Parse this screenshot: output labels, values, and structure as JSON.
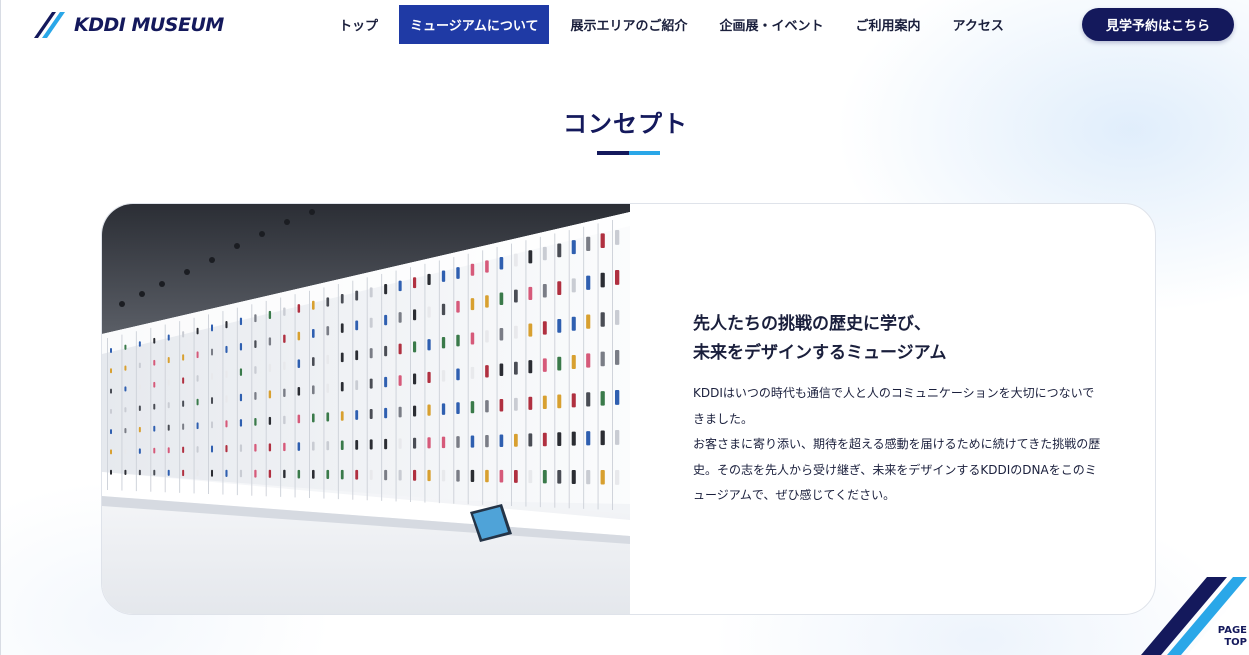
{
  "header": {
    "logo_text": "KDDI MUSEUM",
    "nav": [
      {
        "label": "トップ",
        "active": false
      },
      {
        "label": "ミュージアムについて",
        "active": true
      },
      {
        "label": "展示エリアのご紹介",
        "active": false
      },
      {
        "label": "企画展・イベント",
        "active": false
      },
      {
        "label": "ご利用案内",
        "active": false
      },
      {
        "label": "アクセス",
        "active": false
      }
    ],
    "reserve_label": "見学予約はこちら"
  },
  "section": {
    "title": "コンセプト"
  },
  "concept": {
    "headline_1": "先人たちの挑戦の歴史に学び、",
    "headline_2": "未来をデザインするミュージアム",
    "body_1": "KDDIはいつの時代も通信で人と人のコミュニケーションを大切につないできました。",
    "body_2": "お客さまに寄り添い、期待を超える感動を届けるために続けてきた挑戦の歴史。その志を先人から受け継ぎ、未来をデザインするKDDIのDNAをこのミュージアムで、ぜひ感じてください。"
  },
  "page_top": {
    "label": "PAGE\nTOP"
  },
  "colors": {
    "navy": "#14195c",
    "nav_active": "#1f3aa5",
    "accent_blue": "#2aa7e8",
    "text": "#1a1f3c"
  }
}
